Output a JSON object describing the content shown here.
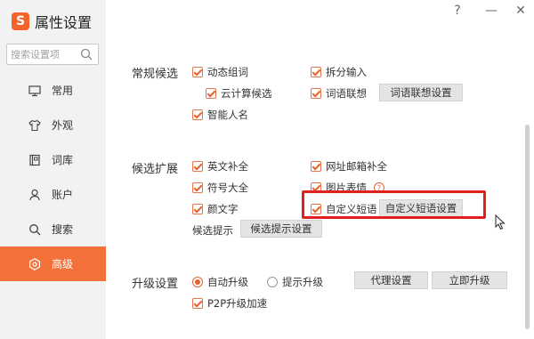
{
  "app": {
    "title": "属性设置",
    "logo_text": "S"
  },
  "window": {
    "help": "?",
    "minimize": "—",
    "close": "✕"
  },
  "search": {
    "placeholder": "搜索设置项"
  },
  "nav": [
    {
      "label": "常用",
      "icon": "monitor-icon"
    },
    {
      "label": "外观",
      "icon": "shirt-icon"
    },
    {
      "label": "词库",
      "icon": "book-icon"
    },
    {
      "label": "账户",
      "icon": "user-icon"
    },
    {
      "label": "搜索",
      "icon": "search-icon"
    },
    {
      "label": "高级",
      "icon": "gear-icon",
      "active": true
    }
  ],
  "sections": {
    "candidates": {
      "title": "常规候选",
      "dynamic_words": "动态组词",
      "split_input": "拆分输入",
      "cloud_candidates": "云计算候选",
      "word_association": "词语联想",
      "word_association_button": "词语联想设置",
      "smart_name": "智能人名"
    },
    "extension": {
      "title": "候选扩展",
      "english_complete": "英文补全",
      "url_email_complete": "网址邮箱补全",
      "symbols": "符号大全",
      "image_emoji": "图片表情",
      "kaomoji": "颜文字",
      "custom_phrase": "自定义短语",
      "custom_phrase_button": "自定义短语设置",
      "hint_label": "候选提示",
      "hint_button": "候选提示设置"
    },
    "upgrade": {
      "title": "升级设置",
      "auto_upgrade": "自动升级",
      "prompt_upgrade": "提示升级",
      "proxy_button": "代理设置",
      "upgrade_now_button": "立即升级",
      "p2p": "P2P升级加速"
    }
  },
  "colors": {
    "accent": "#f5713b",
    "highlight": "#e0201f"
  }
}
